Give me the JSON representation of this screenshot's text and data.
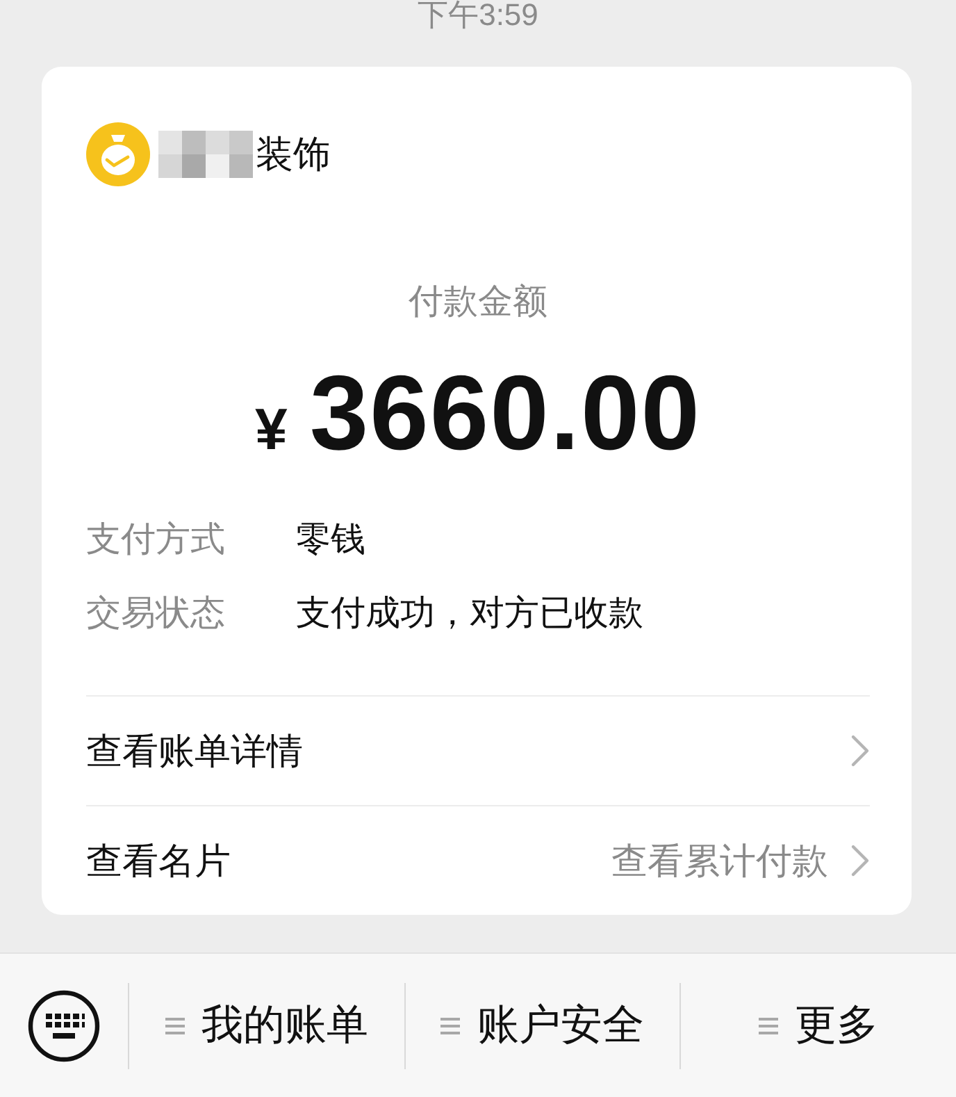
{
  "status_bar": {
    "time": "下午3:59"
  },
  "merchant": {
    "name": "装饰",
    "name_blurred": true
  },
  "payment": {
    "label": "付款金额",
    "currency": "¥",
    "amount": "3660.00"
  },
  "details": [
    {
      "label": "支付方式",
      "value": "零钱"
    },
    {
      "label": "交易状态",
      "value": "支付成功，对方已收款"
    }
  ],
  "links": [
    {
      "label": "查看账单详情"
    },
    {
      "label": "查看名片",
      "hint": "查看累计付款"
    }
  ],
  "bottom_menu": {
    "items": [
      {
        "label": "我的账单"
      },
      {
        "label": "账户安全"
      },
      {
        "label": "更多"
      }
    ]
  }
}
